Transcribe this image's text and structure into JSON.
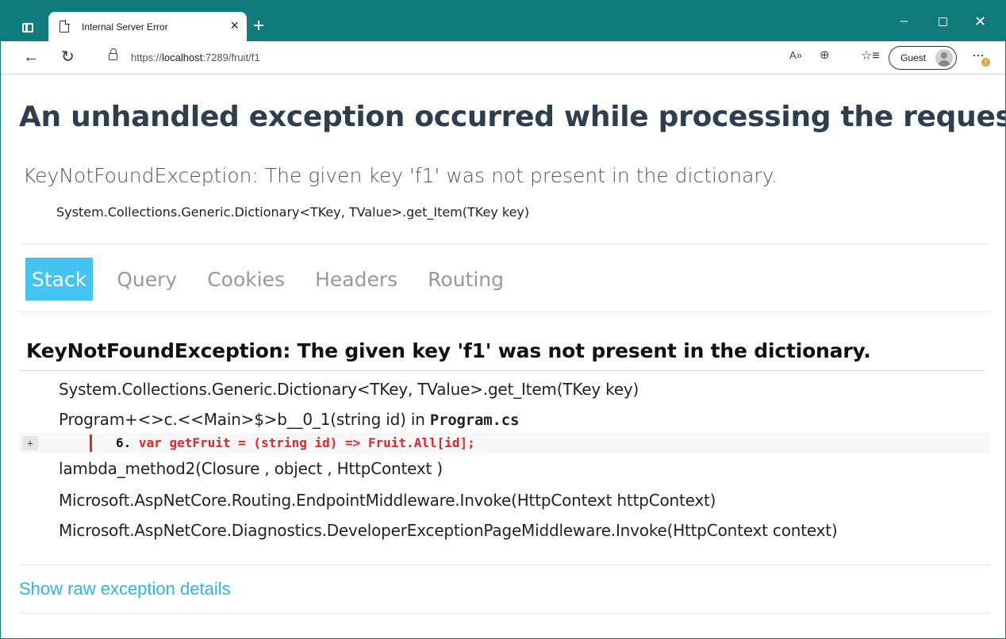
{
  "browser": {
    "tab_title": "Internal Server Error",
    "tab_close": "×",
    "new_tab": "+",
    "url_prefix": "https://",
    "url_host": "localhost",
    "url_rest": ":7289/fruit/f1",
    "profile_label": "Guest",
    "window_min": "–",
    "window_close": "✕",
    "back_glyph": "←",
    "reload_glyph": "↻",
    "readaloud_glyph": "A»",
    "zoom_glyph": "⊕",
    "fav_glyph": "☆≡",
    "more_glyph": "···",
    "more_badge": "!"
  },
  "page": {
    "heading": "An unhandled exception occurred while processing the request.",
    "summary_title": "KeyNotFoundException: The given key 'f1' was not present in the dictionary.",
    "summary_location": "System.Collections.Generic.Dictionary<TKey, TValue>.get_Item(TKey key)",
    "tabs": [
      {
        "label": "Stack",
        "active": true
      },
      {
        "label": "Query",
        "active": false
      },
      {
        "label": "Cookies",
        "active": false
      },
      {
        "label": "Headers",
        "active": false
      },
      {
        "label": "Routing",
        "active": false
      }
    ],
    "stack": {
      "title": "KeyNotFoundException: The given key 'f1' was not present in the dictionary.",
      "frames": [
        {
          "text": "System.Collections.Generic.Dictionary<TKey, TValue>.get_Item(TKey key)"
        },
        {
          "text": "Program+<>c.<<Main>$>b__0_1(string id) in ",
          "file": "Program.cs"
        },
        {
          "text": "lambda_method2(Closure , object , HttpContext )"
        },
        {
          "text": "Microsoft.AspNetCore.Routing.EndpointMiddleware.Invoke(HttpContext httpContext)"
        },
        {
          "text": "Microsoft.AspNetCore.Diagnostics.DeveloperExceptionPageMiddleware.Invoke(HttpContext context)"
        }
      ],
      "code": {
        "expand_label": "+",
        "line_number": "6.",
        "line_text": "var getFruit = (string id) => Fruit.All[id];"
      }
    },
    "raw_link": "Show raw exception details"
  },
  "colors": {
    "titlebar": "#0f7b7c",
    "active_tab": "#44c5f1",
    "heading": "#2f3e4e",
    "error_code": "#e3262b",
    "link": "#2db5e8"
  }
}
